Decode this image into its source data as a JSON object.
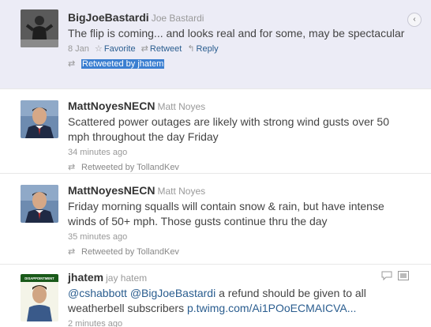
{
  "tweets": [
    {
      "screen_name": "BigJoeBastardi",
      "full_name": "Joe Bastardi",
      "text": "The flip is coming... and looks real and for some, may be spectacular",
      "time": "8 Jan",
      "favorite_label": "Favorite",
      "retweet_label": "Retweet",
      "reply_label": "Reply",
      "retweeted_by": "Retweeted by jhatem"
    },
    {
      "screen_name": "MattNoyesNECN",
      "full_name": "Matt Noyes",
      "text": "Scattered power outages are likely with strong wind gusts over 50 mph throughout the day Friday",
      "time": "34 minutes ago",
      "retweeted_by": "Retweeted by TollandKev"
    },
    {
      "screen_name": "MattNoyesNECN",
      "full_name": "Matt Noyes",
      "text": "Friday morning squalls will contain snow & rain, but have intense winds of 50+ mph. Those gusts continue thru the day",
      "time": "35 minutes ago",
      "retweeted_by": "Retweeted by TollandKev"
    },
    {
      "screen_name": "jhatem",
      "full_name": "jay hatem",
      "mention1": "@cshabbott",
      "mention2": "@BigJoeBastardi",
      "text_rest": " a refund should be given to all weatherbell subscribers ",
      "link": "p.twimg.com/Ai1POoECMAICVA...",
      "time": "2 minutes ago"
    }
  ],
  "avatar_text_4": "DISAPPOINTMENT",
  "icons": {
    "chevron": "chevron-left-icon",
    "star": "star-icon",
    "retweet": "retweet-icon",
    "reply": "reply-icon"
  },
  "colors": {
    "selected_bg": "#ececf6",
    "link": "#2a5d8f",
    "highlight": "#3b7fd1"
  }
}
